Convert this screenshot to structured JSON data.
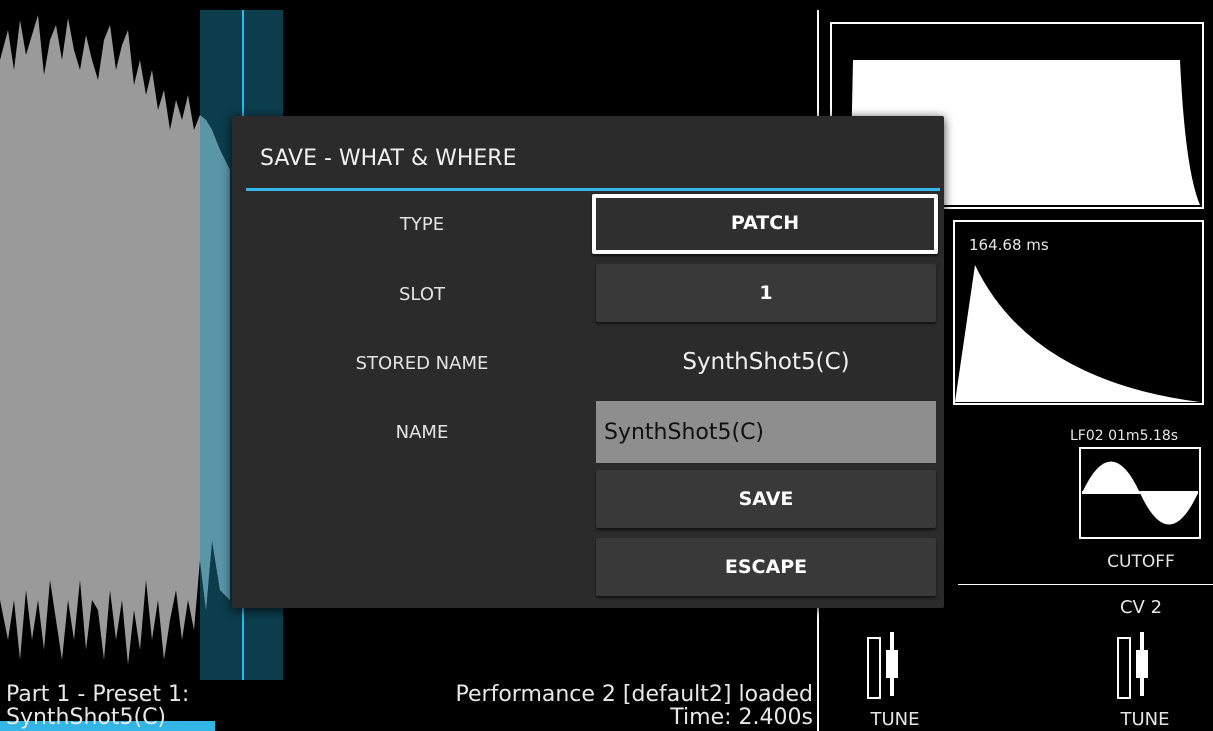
{
  "status": {
    "part_line1": "Part 1 - Preset 1:",
    "part_line2": "SynthShot5(C)",
    "performance": "Performance 2 [default2] loaded",
    "time": "Time: 2.400s"
  },
  "panel": {
    "env_time": "164.68 ms",
    "lfo_label": "LF02 01m5.18s",
    "lfo_target": "CUTOFF",
    "cv_label": "CV 2",
    "tune_left": "TUNE",
    "tune_right": "TUNE"
  },
  "dialog": {
    "title": "SAVE - WHAT & WHERE",
    "type_label": "TYPE",
    "type_value": "PATCH",
    "slot_label": "SLOT",
    "slot_value": "1",
    "stored_name_label": "STORED NAME",
    "stored_name_value": "SynthShot5(C)",
    "name_label": "NAME",
    "name_value": "SynthShot5(C)",
    "save_label": "SAVE",
    "escape_label": "ESCAPE"
  },
  "colors": {
    "accent": "#33b5e5",
    "waveform": "#9a9a9a",
    "selection": "#0b3d4c"
  },
  "icons": [
    "cable-jack-icon",
    "cable-jack-icon"
  ]
}
